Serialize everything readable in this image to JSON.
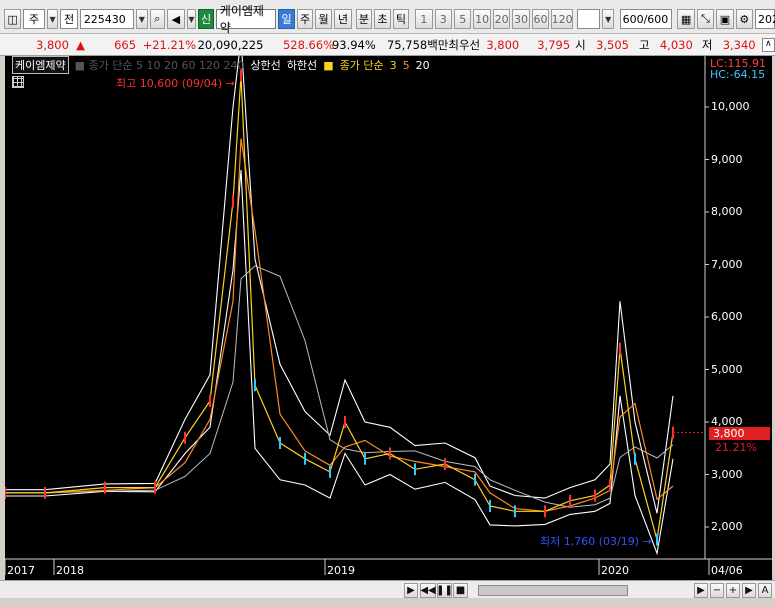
{
  "toolbar": {
    "market_label": "주",
    "prev_label": "전",
    "code": "225430",
    "search_icon": "search-icon",
    "sound_icon": "speaker-icon",
    "new_label": "신",
    "stock_name": "케이엠제약",
    "periods": [
      "일",
      "주",
      "월",
      "년",
      "분",
      "초",
      "틱"
    ],
    "selected_period": "일",
    "intervals": [
      "1",
      "3",
      "5",
      "10",
      "20",
      "30",
      "60",
      "120"
    ],
    "count": "600",
    "count_total": "/600",
    "right_year": "202"
  },
  "quote": {
    "price": "3,800",
    "up_symbol": "▲",
    "change": "665",
    "change_pct": "+21.21%",
    "volume": "20,090,225",
    "vol_ratio": "528.66%",
    "turnover": "93.94%",
    "amount": "75,758백만",
    "best_bid_label": "최우선",
    "best_ask": "3,800",
    "best_bid": "3,795",
    "open_label": "시",
    "open": "3,505",
    "high_label": "고",
    "high": "4,030",
    "low_label": "저",
    "low": "3,340"
  },
  "legend": {
    "stock": "케이엠제약",
    "hidden": "■ 종가 단순 5 10 20 60 120 240",
    "upper": "상한선",
    "lower": "하한선",
    "ma_label": "종가 단순",
    "ma1": "3",
    "ma2": "5",
    "ma3": "20",
    "lc": "LC:115.91",
    "hc": "HC:-64.15"
  },
  "annotations": {
    "high": "최고 10,600 (09/04)",
    "low": "최저 1,760 (03/19)",
    "last_price": "3,800",
    "last_pct": "21.21%"
  },
  "chart_data": {
    "type": "line",
    "title": "",
    "y_ticks": [
      "10,000",
      "9,000",
      "8,000",
      "7,000",
      "6,000",
      "5,000",
      "4,000",
      "3,000",
      "2,000"
    ],
    "x_ticks": [
      "2017",
      "2018",
      "2019",
      "2020",
      "04/06"
    ],
    "ylim": [
      1500,
      10600
    ],
    "series": [
      {
        "name": "종가",
        "x": [
          "2017-09",
          "2017-11",
          "2018-01",
          "2018-03",
          "2018-05",
          "2018-07",
          "2018-08",
          "2018-09-04",
          "2018-10",
          "2018-11",
          "2018-12",
          "2019-01",
          "2019-02",
          "2019-03",
          "2019-04",
          "2019-05",
          "2019-06",
          "2019-07",
          "2019-08",
          "2019-09",
          "2019-10",
          "2019-11",
          "2019-12",
          "2020-01",
          "2020-02",
          "2020-03",
          "2020-03-19",
          "2020-04"
        ],
        "values": [
          2650,
          2650,
          2750,
          2750,
          3700,
          4400,
          8200,
          10600,
          4700,
          3600,
          3300,
          3050,
          4000,
          3300,
          3400,
          3100,
          3200,
          2900,
          2400,
          2300,
          2300,
          2500,
          2600,
          2800,
          5400,
          3300,
          1760,
          3800
        ]
      }
    ],
    "high": {
      "value": 10600,
      "date": "09/04"
    },
    "low": {
      "value": 1760,
      "date": "03/19"
    },
    "last": 3800,
    "grid": false
  },
  "scrollbar": {
    "left_arrow": "◀",
    "right_arrow": "▶",
    "prev": "◀◀",
    "pause": "❚❚",
    "stop": "■",
    "fwd": "▶",
    "zoom_out": "−",
    "zoom_in": "+",
    "auto": "A"
  }
}
